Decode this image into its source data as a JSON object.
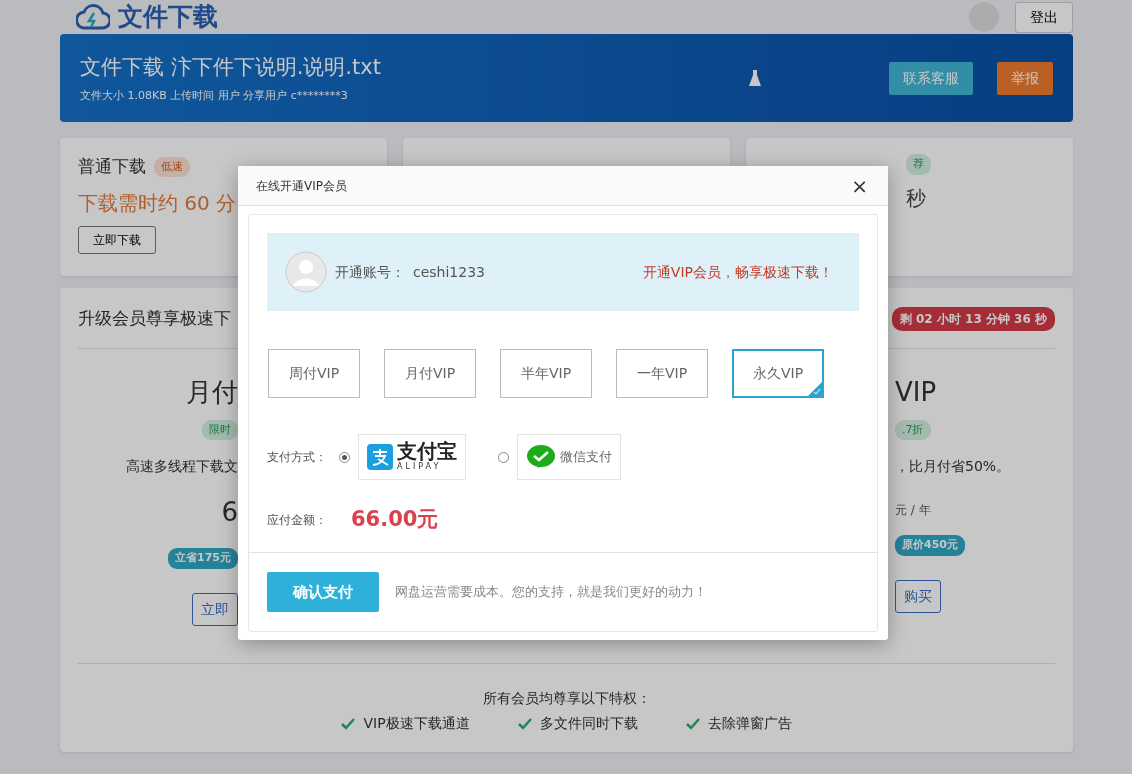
{
  "header": {
    "title": "文件下载",
    "logout": "登出"
  },
  "banner": {
    "title": "文件下载 汴下件下说明.说明.txt",
    "meta": "文件大小 1.08KB  上传时间 用户 分享用户 c********3",
    "buttons": [
      {
        "label": "联系客服",
        "kind": "info"
      },
      {
        "label": "举报",
        "kind": "warning"
      }
    ]
  },
  "download_cards": [
    {
      "title": "普通下载",
      "badge": "低速",
      "estimate": "下载需时约 60 分",
      "button": "立即下载"
    },
    {
      "badge": "荐",
      "estimate": "秒"
    }
  ],
  "upgrade": {
    "title": "升级会员尊享极速下",
    "countdown": "剩 02 小时 13 分钟 36 秒",
    "plans": [
      {
        "name": "月付",
        "tag": "限时",
        "desc": "高速多线程下载文",
        "price": "6",
        "saving": "立省175元",
        "button": "立即"
      },
      {
        "name": "VIP",
        "tag": ".7折",
        "desc": "，比月付省50%。",
        "price": "元 / 年",
        "saving": "原价450元",
        "button": "购买"
      }
    ],
    "benefits_title": "所有会员均尊享以下特权：",
    "benefits": [
      "VIP极速下载通道",
      "多文件同时下载",
      "去除弹窗广告"
    ]
  },
  "modal": {
    "title": "在线开通VIP会员",
    "close": "×",
    "account_label": "开通账号：",
    "account": "ceshi1233",
    "slogan": "开通VIP会员，畅享极速下载！",
    "plans": [
      {
        "label": "周付VIP",
        "selected": false
      },
      {
        "label": "月付VIP",
        "selected": false
      },
      {
        "label": "半年VIP",
        "selected": false
      },
      {
        "label": "一年VIP",
        "selected": false
      },
      {
        "label": "永久VIP",
        "selected": true
      }
    ],
    "payment_label": "支付方式：",
    "payment_methods": [
      {
        "kind": "alipay",
        "label": "支付宝",
        "sublabel": "ALIPAY",
        "selected": true
      },
      {
        "kind": "wechat",
        "label": "微信支付",
        "selected": false
      }
    ],
    "amount_label": "应付金额：",
    "amount": "66.00元",
    "confirm": "确认支付",
    "note": "网盘运营需要成本。您的支持，就是我们更好的动力！"
  }
}
